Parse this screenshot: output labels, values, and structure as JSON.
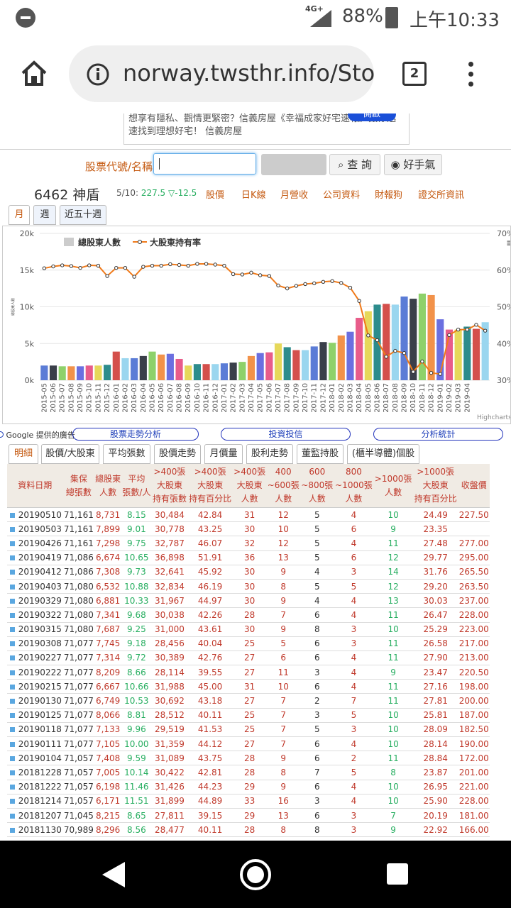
{
  "status": {
    "network": "4G+",
    "battery": "88%",
    "time": "上午10:33"
  },
  "browser": {
    "url": "norway.twsthr.info/Stoc",
    "tab_count": "2"
  },
  "ad": {
    "text": "想享有隱私、觀情更緊密？信義房屋《幸福成家好宅速報》讓你迅速找到理想好宅！ 信義房屋",
    "button": "開啟"
  },
  "search": {
    "label": "股票代號/名稱",
    "query_button": "查 詢",
    "hand_button": "好手氣"
  },
  "stock": {
    "name": "6462 神盾",
    "date": "5/10:",
    "price": "227.5",
    "change": "▽-12.5"
  },
  "nav_links": [
    "股價",
    "日K線",
    "月營收",
    "公司資料",
    "財報狗",
    "證交所資訊"
  ],
  "period_tabs": [
    "月",
    "週",
    "近五十週"
  ],
  "chart_data": {
    "type": "bar",
    "legend": [
      "總股東人數",
      "大股東持有率"
    ],
    "ylim_left": [
      0,
      20000
    ],
    "ylim_right": [
      30,
      70
    ],
    "left_ticks": [
      "0k",
      "5k",
      "10k",
      "15k",
      "20k"
    ],
    "right_ticks": [
      "30%",
      "40%",
      "50%",
      "60%",
      "70%"
    ],
    "ylabel": "總股東人數",
    "credit": "Highcharts.com",
    "categories": [
      "2015-05",
      "2015-06",
      "2015-07",
      "2015-08",
      "2015-09",
      "2015-10",
      "2015-11",
      "2015-12",
      "2016-01",
      "2016-02",
      "2016-03",
      "2016-04",
      "2016-05",
      "2016-06",
      "2016-07",
      "2016-08",
      "2016-09",
      "2016-10",
      "2016-11",
      "2016-12",
      "2017-01",
      "2017-02",
      "2017-03",
      "2017-04",
      "2017-05",
      "2017-06",
      "2017-07",
      "2017-08",
      "2017-09",
      "2017-10",
      "2017-11",
      "2017-12",
      "2018-01",
      "2018-02",
      "2018-03",
      "2018-04",
      "2018-05",
      "2018-06",
      "2018-07",
      "2018-08",
      "2018-09",
      "2018-10",
      "2018-11",
      "2018-12",
      "2019-01",
      "2019-02",
      "2019-03",
      "2019-04"
    ],
    "bars": [
      2000,
      2000,
      1900,
      1900,
      1900,
      2000,
      2000,
      2100,
      3900,
      3000,
      3000,
      3300,
      3900,
      3500,
      3600,
      2900,
      2000,
      2200,
      2200,
      2200,
      2300,
      2400,
      2500,
      3300,
      3700,
      3800,
      5000,
      4500,
      4100,
      4100,
      4600,
      5200,
      5100,
      6100,
      6600,
      8500,
      9400,
      10300,
      10400,
      10300,
      11400,
      11100,
      11800,
      11600,
      8300,
      6900,
      6900,
      7300,
      7000,
      7900
    ],
    "line": [
      60.5,
      61.0,
      61.3,
      61.1,
      60.6,
      61.3,
      61.2,
      58.4,
      60.6,
      60.6,
      58.2,
      60.9,
      61.2,
      61.2,
      61.6,
      61.4,
      61.2,
      61.7,
      61.7,
      61.5,
      61.2,
      58.9,
      58.8,
      59.3,
      58.6,
      58.4,
      55.8,
      55.0,
      55.7,
      56.2,
      56.4,
      56.8,
      57.0,
      56.5,
      55.2,
      51.6,
      42.2,
      40.9,
      36.4,
      38.0,
      37.4,
      32.3,
      35.1,
      32.0,
      31.7,
      42.3,
      43.8,
      43.8,
      45.1,
      43.5
    ]
  },
  "section_links": [
    "股票走勢分析",
    "投資投信",
    "分析統計"
  ],
  "google_ad": "Google 提供的廣告",
  "data_tabs": [
    "明細",
    "股價/大股東",
    "平均張數",
    "股價走勢",
    "月價量",
    "股利走勢",
    "董監持股",
    "(櫃半導體)個股"
  ],
  "table": {
    "headers": [
      "資料日期",
      "集保\n總張數",
      "總股東\n人數",
      "平均\n張數/人",
      ">400張\n大股東\n持有張數",
      ">400張\n大股東\n持有百分比",
      ">400張\n大股東\n人數",
      "400\n~600張\n人數",
      "600\n~800張\n人數",
      "800\n~1000張\n人數",
      ">1000張\n人數",
      ">1000張\n大股東\n持有百分比",
      "收盤價"
    ],
    "rows": [
      [
        "20190510",
        "71,161",
        "8,731",
        "8.15",
        "30,484",
        "42.84",
        "31",
        "12",
        "5",
        "4",
        "10",
        "24.49",
        "227.50"
      ],
      [
        "20190503",
        "71,161",
        "7,899",
        "9.01",
        "30,778",
        "43.25",
        "30",
        "10",
        "5",
        "6",
        "9",
        "23.35",
        ""
      ],
      [
        "20190426",
        "71,161",
        "7,298",
        "9.75",
        "32,787",
        "46.07",
        "32",
        "12",
        "5",
        "4",
        "11",
        "27.48",
        "277.00"
      ],
      [
        "20190419",
        "71,086",
        "6,674",
        "10.65",
        "36,898",
        "51.91",
        "36",
        "13",
        "5",
        "6",
        "12",
        "29.77",
        "295.00"
      ],
      [
        "20190412",
        "71,086",
        "7,308",
        "9.73",
        "32,641",
        "45.92",
        "30",
        "9",
        "4",
        "3",
        "14",
        "31.76",
        "265.50"
      ],
      [
        "20190403",
        "71,080",
        "6,532",
        "10.88",
        "32,834",
        "46.19",
        "30",
        "8",
        "5",
        "5",
        "12",
        "29.20",
        "263.50"
      ],
      [
        "20190329",
        "71,080",
        "6,881",
        "10.33",
        "31,967",
        "44.97",
        "30",
        "9",
        "4",
        "4",
        "13",
        "30.03",
        "237.00"
      ],
      [
        "20190322",
        "71,080",
        "7,341",
        "9.68",
        "30,038",
        "42.26",
        "28",
        "7",
        "6",
        "4",
        "11",
        "26.47",
        "228.00"
      ],
      [
        "20190315",
        "71,080",
        "7,687",
        "9.25",
        "31,000",
        "43.61",
        "30",
        "9",
        "8",
        "3",
        "10",
        "25.29",
        "223.00"
      ],
      [
        "20190308",
        "71,077",
        "7,745",
        "9.18",
        "28,456",
        "40.04",
        "25",
        "5",
        "6",
        "3",
        "11",
        "26.58",
        "217.00"
      ],
      [
        "20190227",
        "71,077",
        "7,314",
        "9.72",
        "30,389",
        "42.76",
        "27",
        "6",
        "6",
        "4",
        "11",
        "27.90",
        "213.00"
      ],
      [
        "20190222",
        "71,077",
        "8,209",
        "8.66",
        "28,114",
        "39.55",
        "27",
        "11",
        "3",
        "4",
        "9",
        "23.47",
        "220.50"
      ],
      [
        "20190215",
        "71,077",
        "6,667",
        "10.66",
        "31,988",
        "45.00",
        "31",
        "10",
        "6",
        "4",
        "11",
        "27.16",
        "198.00"
      ],
      [
        "20190130",
        "71,077",
        "6,749",
        "10.53",
        "30,692",
        "43.18",
        "27",
        "7",
        "2",
        "7",
        "11",
        "27.81",
        "200.00"
      ],
      [
        "20190125",
        "71,077",
        "8,066",
        "8.81",
        "28,512",
        "40.11",
        "25",
        "7",
        "3",
        "5",
        "10",
        "25.81",
        "187.00"
      ],
      [
        "20190118",
        "71,077",
        "7,133",
        "9.96",
        "29,519",
        "41.53",
        "25",
        "7",
        "5",
        "3",
        "10",
        "28.09",
        "182.50"
      ],
      [
        "20190111",
        "71,077",
        "7,105",
        "10.00",
        "31,359",
        "44.12",
        "27",
        "7",
        "6",
        "4",
        "10",
        "28.14",
        "190.00"
      ],
      [
        "20190104",
        "71,057",
        "7,408",
        "9.59",
        "31,089",
        "43.75",
        "28",
        "9",
        "6",
        "2",
        "11",
        "28.84",
        "172.00"
      ],
      [
        "20181228",
        "71,057",
        "7,005",
        "10.14",
        "30,422",
        "42.81",
        "28",
        "8",
        "7",
        "5",
        "8",
        "23.87",
        "201.00"
      ],
      [
        "20181222",
        "71,057",
        "6,198",
        "11.46",
        "31,426",
        "44.23",
        "29",
        "9",
        "6",
        "4",
        "10",
        "26.95",
        "221.00"
      ],
      [
        "20181214",
        "71,057",
        "6,171",
        "11.51",
        "31,899",
        "44.89",
        "33",
        "16",
        "3",
        "4",
        "10",
        "25.90",
        "228.00"
      ],
      [
        "20181207",
        "71,045",
        "8,215",
        "8.65",
        "27,811",
        "39.15",
        "29",
        "13",
        "6",
        "3",
        "7",
        "20.19",
        "181.00"
      ],
      [
        "20181130",
        "70,989",
        "8,296",
        "8.56",
        "28,477",
        "40.11",
        "28",
        "8",
        "8",
        "3",
        "9",
        "22.92",
        "166.00"
      ]
    ]
  },
  "colors": [
    "#5b7cd6",
    "#3a3f4a",
    "#8ed16a",
    "#f2924a",
    "#6b6fe0",
    "#e85c8a",
    "#e6d85a",
    "#2c8c8c",
    "#d4504c",
    "#9ad6ef"
  ]
}
